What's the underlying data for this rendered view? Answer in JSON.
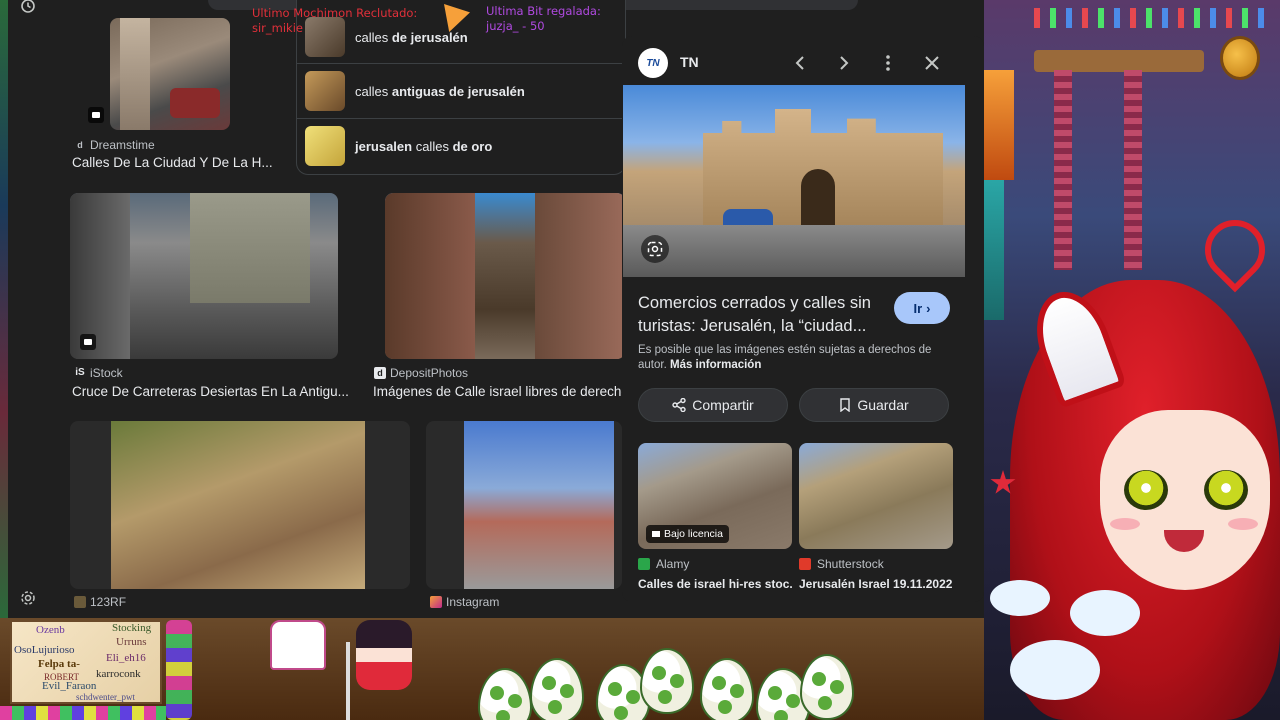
{
  "overlay": {
    "recruit_label": "Ultimo Mochimon Reclutado:",
    "recruit_user": "sir_mikie",
    "bits_label": "Ultima Bit regalada:",
    "bits_user": "juzja_ - 50"
  },
  "related_searches": [
    {
      "pre": "calles ",
      "bold": "de jerusalén",
      "post": ""
    },
    {
      "pre": "calles ",
      "bold": "antiguas de jerusalén",
      "post": ""
    },
    {
      "pre": "",
      "bold": "jerusalen",
      "post": " calles ",
      "bold2": "de oro"
    }
  ],
  "results": [
    {
      "source": "Dreamstime",
      "caption": "Calles De La Ciudad Y De La H..."
    },
    {
      "source": "iStock",
      "caption": "Cruce De Carreteras Desiertas En La Antigu..."
    },
    {
      "source": "DepositPhotos",
      "caption": "Imágenes de Calle israel libres de derecho"
    },
    {
      "source": "123RF",
      "caption": ""
    },
    {
      "source": "Instagram",
      "caption": ""
    }
  ],
  "panel": {
    "logo": "TN",
    "source": "TN",
    "title": "Comercios cerrados y calles sin turistas: Jerusalén, la “ciudad...",
    "go_label": "Ir",
    "note": "Es posible que las imágenes estén sujetas a derechos de autor.",
    "note_link": "Más información",
    "share_label": "Compartir",
    "save_label": "Guardar",
    "similar": [
      {
        "badge": "Bajo licencia",
        "source": "Alamy",
        "caption": "Calles de israel hi-res stoc..."
      },
      {
        "badge": "",
        "source": "Shutterstock",
        "caption": "Jerusalén Israel 19.11.2022..."
      }
    ]
  },
  "chat_names": [
    "Ozenb",
    "Stocking",
    "Urruns",
    "OsoLujurioso",
    "Eli_eh16",
    "Felpa ta-",
    "karroconk",
    "ROBERT",
    "Evil_Faraon",
    "schdwenter_pwt"
  ],
  "icons": {
    "history": "history-icon",
    "settings": "gear-icon",
    "prev": "chevron-left-icon",
    "next": "chevron-right-icon",
    "more": "more-vert-icon",
    "close": "close-icon",
    "lens": "lens-icon",
    "share": "share-icon",
    "bookmark": "bookmark-icon"
  },
  "colors": {
    "accent": "#a8c7fa",
    "panel_bg": "#1f1f1f",
    "alert_purple": "#b04ae0",
    "alert_red": "#e0303a"
  }
}
